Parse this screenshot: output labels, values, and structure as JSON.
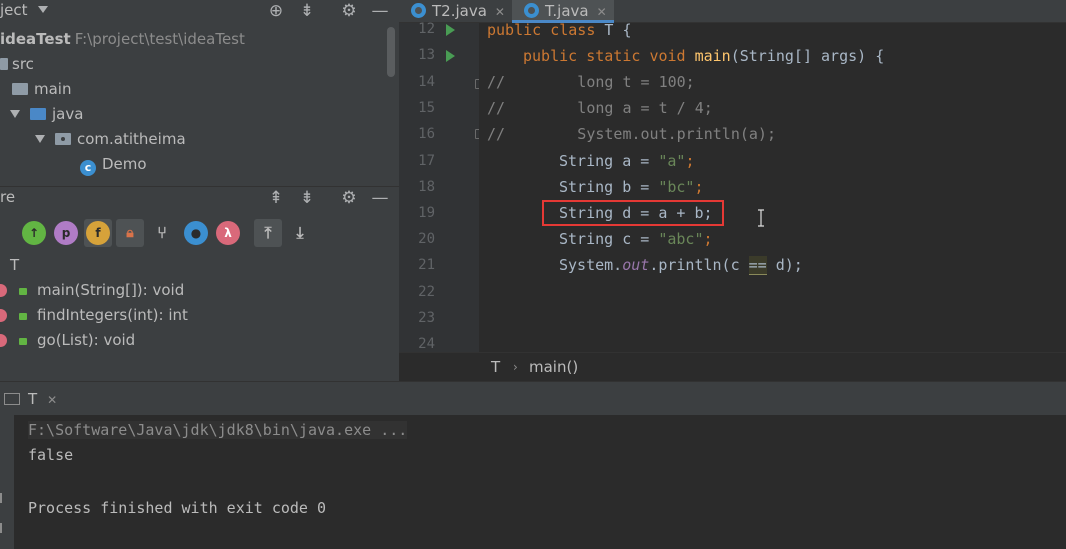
{
  "project_panel": {
    "title": "ject",
    "root_name": "ideaTest",
    "root_path": "F:\\project\\test\\ideaTest",
    "items": [
      {
        "label": "src"
      },
      {
        "label": "main"
      },
      {
        "label": "java"
      },
      {
        "label": "com.atitheima"
      },
      {
        "label": "Demo"
      }
    ]
  },
  "structure_panel": {
    "title": "re",
    "class_name": "T",
    "members": [
      {
        "label": "main(String[]): void"
      },
      {
        "label": "findIntegers(int): int"
      },
      {
        "label": "go(List): void"
      }
    ],
    "toolbar_letters": {
      "p": "p",
      "f": "f",
      "lambda": "λ"
    }
  },
  "editor": {
    "tabs": [
      {
        "label": "T2.java",
        "active": false
      },
      {
        "label": "T.java",
        "active": true
      }
    ],
    "line_numbers": [
      "12",
      "13",
      "14",
      "15",
      "16",
      "17",
      "18",
      "19",
      "20",
      "21",
      "22",
      "23",
      "24"
    ],
    "code": {
      "l12_kw1": "public",
      "l12_kw2": "class",
      "l12_rest": " T {",
      "l13_kw1": "public",
      "l13_kw2": "static",
      "l13_kw3": "void",
      "l13_fn": "main",
      "l13_rest": "(String[] args) {",
      "l14": "//        long t = 100;",
      "l15": "//        long a = t / 4;",
      "l16": "//        System.out.println(a);",
      "l17_a": "String a = ",
      "l17_s": "\"a\"",
      "l17_e": ";",
      "l18_a": "String b = ",
      "l18_s": "\"bc\"",
      "l18_e": ";",
      "l19": "String d = a + b;",
      "l20_a": "String c = ",
      "l20_s": "\"abc\"",
      "l20_e": ";",
      "l21_a": "System.",
      "l21_out": "out",
      "l21_b": ".println(c ",
      "l21_eq": "==",
      "l21_c": " d);"
    },
    "breadcrumb": {
      "class": "T",
      "separator": "›",
      "method": "main()"
    }
  },
  "run_panel": {
    "tab_label": "T",
    "command": "F:\\Software\\Java\\jdk\\jdk8\\bin\\java.exe ...",
    "output": "false",
    "exit_message": "Process finished with exit code 0"
  },
  "colors": {
    "accent": "#4a88c7",
    "highlight_box": "#e53935",
    "run_green": "#499c54"
  }
}
